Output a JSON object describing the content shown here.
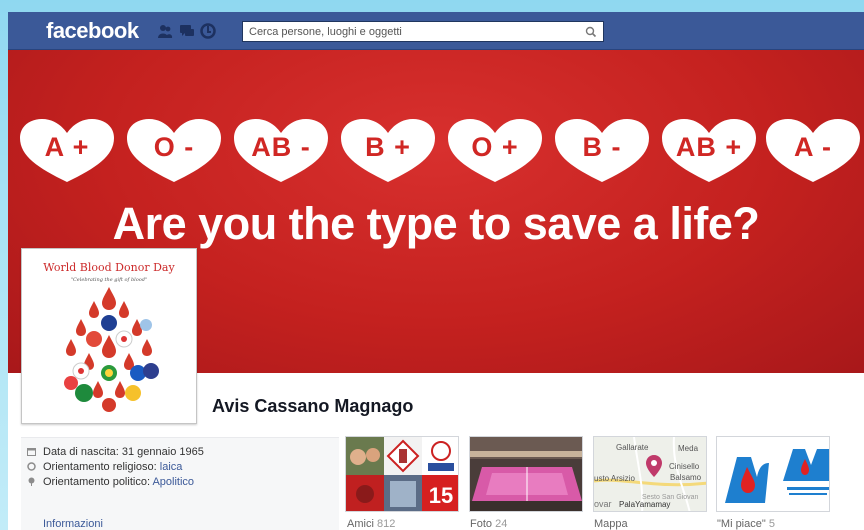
{
  "topbar": {
    "logo": "facebook",
    "search_placeholder": "Cerca persone, luoghi e oggetti",
    "icons": [
      "friend-requests-icon",
      "messages-icon",
      "notifications-icon",
      "search-icon"
    ]
  },
  "cover": {
    "blood_types": [
      "A +",
      "O -",
      "AB -",
      "B +",
      "O +",
      "B -",
      "AB +",
      "A -"
    ],
    "slogan": "Are you the type to save a life?",
    "colors": {
      "background": "#c4211f",
      "heart": "#ffffff",
      "heart_text": "#d02724"
    }
  },
  "profile_picture": {
    "title": "World Blood Donor Day",
    "subtitle": "\"Celebrating the gift of blood\""
  },
  "page": {
    "name": "Avis Cassano Magnago"
  },
  "about": {
    "birth_label": "Data di nascita: 31 gennaio 1965",
    "religion_label": "Orientamento religioso:",
    "religion_value": "laica",
    "political_label": "Orientamento politico:",
    "political_value": "Apolitico",
    "info_link": "Informazioni"
  },
  "tiles": [
    {
      "label": "Amici",
      "count": "812"
    },
    {
      "label": "Foto",
      "count": "24"
    },
    {
      "label": "Mappa",
      "count": ""
    },
    {
      "label": "\"Mi piace\"",
      "count": "5"
    }
  ],
  "map": {
    "places": [
      "Gallarate",
      "Meda",
      "Cinisello",
      "Balsamo",
      "usto Arsizio",
      "ovar",
      "PalaYamamay",
      "Sesto San Giovan"
    ]
  },
  "colors": {
    "facebook_blue": "#3b5998",
    "link": "#3b5998",
    "page_background": "#a8e2f4"
  }
}
